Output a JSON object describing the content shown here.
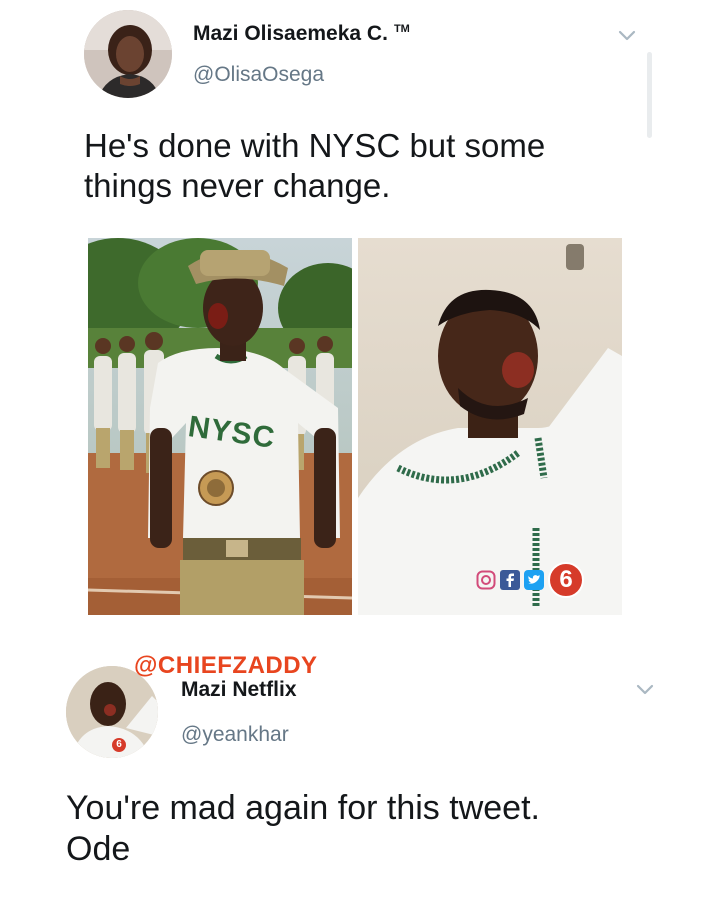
{
  "tweet1": {
    "author_name": "Mazi Olisaemeka C.",
    "tm": "TM",
    "handle": "@OlisaOsega",
    "text_line1": "He's done with NYSC but some",
    "text_line2": "things never change.",
    "photo_left_shirt_text": "NYSC",
    "photo_right_channel_badge": "6"
  },
  "tweet2": {
    "watermark": "@CHIEFZADDY",
    "author_name": "Mazi Netflix",
    "handle": "@yeankhar",
    "avatar_badge": "6",
    "text_line1": "You're mad again for this tweet.",
    "text_line2": "Ode"
  },
  "icons": {
    "menu": "chevron-down-icon",
    "instagram": "instagram-icon",
    "facebook": "facebook-icon",
    "twitter": "twitter-icon"
  },
  "colors": {
    "name": "#14171a",
    "handle": "#657786",
    "chevron": "#aab8c2",
    "watermark": "#e8451f"
  }
}
